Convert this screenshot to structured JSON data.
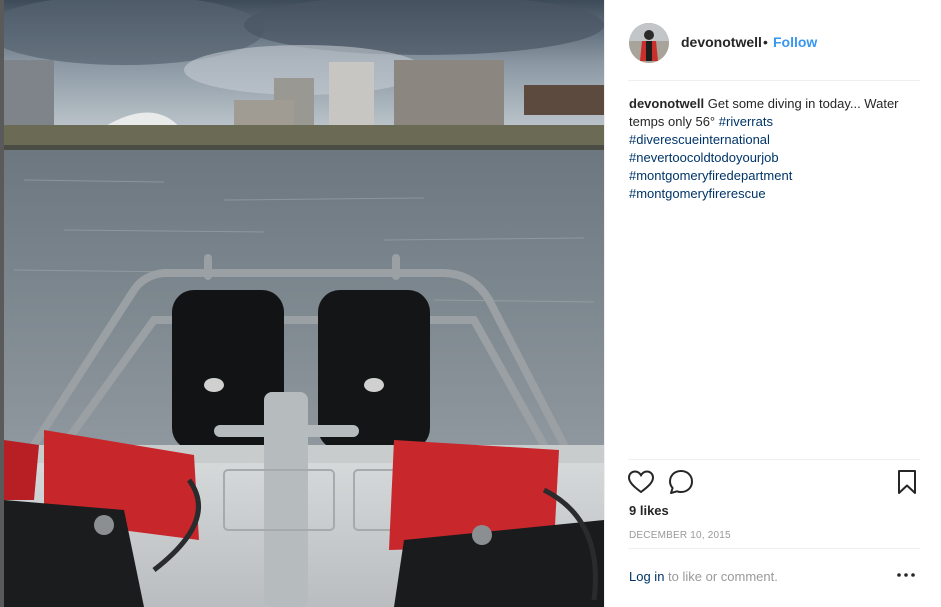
{
  "post": {
    "username": "devonotwell",
    "separator": "•",
    "follow_label": "Follow",
    "caption_user": "devonotwell",
    "caption_text": "Get some diving in today... Water temps only 56°",
    "hashtags": [
      "#riverrats",
      "#diverescueinternational",
      "#nevertoocoldtodoyourjob",
      "#montgomeryfiredepartment",
      "#montgomeryfirerescue"
    ],
    "likes": "9 likes",
    "date": "DECEMBER 10, 2015",
    "login_link": "Log in",
    "login_suffix": "to like or comment."
  },
  "icons": {
    "like": "heart-icon",
    "comment": "comment-bubble-icon",
    "save": "bookmark-icon",
    "more": "more-options-icon"
  },
  "colors": {
    "accent": "#3897f0",
    "hashtag": "#003569",
    "muted": "#999999",
    "text": "#262626",
    "divider": "#efefef"
  }
}
